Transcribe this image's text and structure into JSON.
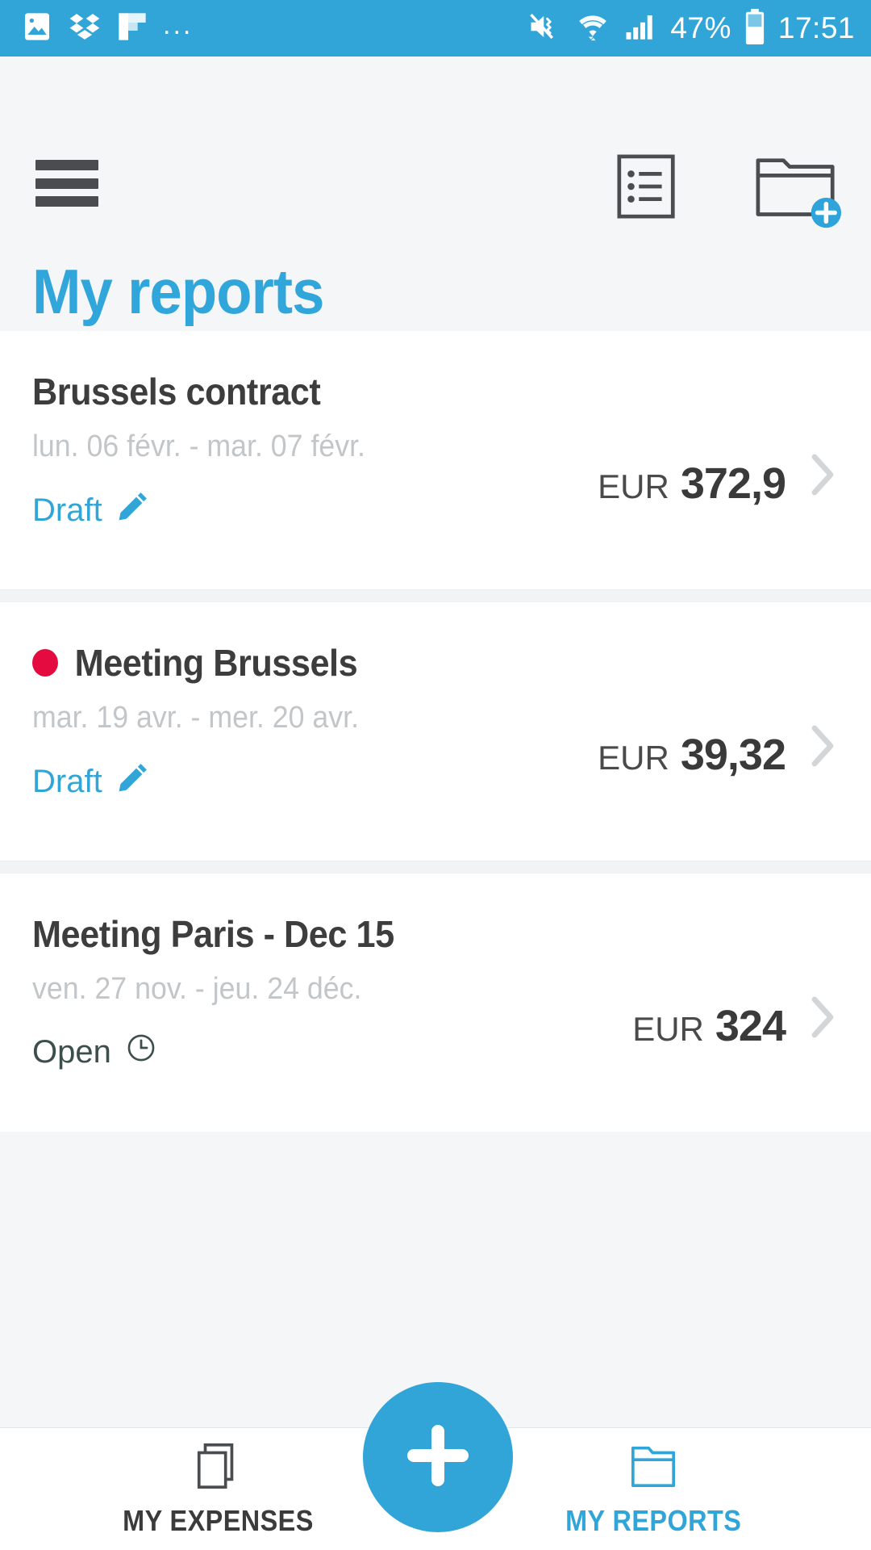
{
  "status_bar": {
    "background": "#32a5d8",
    "left_icons": [
      "photo-icon",
      "dropbox-icon",
      "flipboard-icon",
      "overflow-dots-icon"
    ],
    "overflow": "...",
    "right_icons": [
      "mute-vibrate-icon",
      "wifi-icon",
      "signal-icon",
      "battery-icon"
    ],
    "battery_percent": "47%",
    "time": "17:51"
  },
  "header": {
    "menu_icon": "hamburger-menu-icon",
    "list_icon": "list-view-icon",
    "add_folder_icon": "new-folder-icon",
    "title": "My reports",
    "title_color": "#31a6da"
  },
  "reports": [
    {
      "title": "Brussels contract",
      "has_alert_dot": false,
      "dates": "lun. 06 févr. - mar. 07 févr.",
      "currency": "EUR",
      "amount": "372,9",
      "status": "Draft",
      "status_icon": "pencil-icon",
      "status_color": "#32a5d8"
    },
    {
      "title": "Meeting Brussels",
      "has_alert_dot": true,
      "alert_color": "#e30b3f",
      "dates": "mar. 19 avr. - mer. 20 avr.",
      "currency": "EUR",
      "amount": "39,32",
      "status": "Draft",
      "status_icon": "pencil-icon",
      "status_color": "#32a5d8"
    },
    {
      "title": "Meeting Paris -  Dec 15",
      "has_alert_dot": false,
      "dates": "ven. 27 nov. - jeu. 24 déc.",
      "currency": "EUR",
      "amount": "324",
      "status": "Open",
      "status_icon": "clock-icon",
      "status_color": "#3d4f4d"
    }
  ],
  "bottom_nav": {
    "expenses": {
      "label": "MY EXPENSES",
      "icon": "stacked-pages-icon",
      "active": false,
      "color": "#3b3b3b"
    },
    "reports": {
      "label": "MY REPORTS",
      "icon": "folder-icon",
      "active": true,
      "color": "#32a5d8"
    },
    "fab": {
      "icon": "plus-icon",
      "color": "#32a5d8"
    }
  }
}
